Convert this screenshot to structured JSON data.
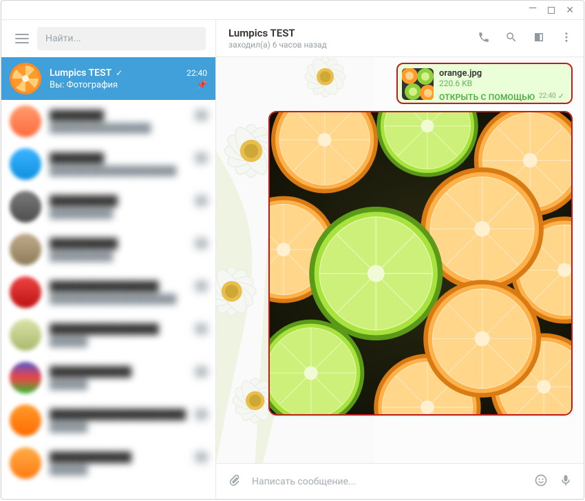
{
  "window_controls": {
    "minimize": "—",
    "maximize": "▢",
    "close": "✕"
  },
  "search": {
    "placeholder": "Найти..."
  },
  "active_chat": {
    "name": "Lumpics TEST",
    "time": "22:40",
    "preview_prefix": "Вы: ",
    "preview": "Фотография"
  },
  "header": {
    "title": "Lumpics TEST",
    "status": "заходил(а) 6 часов назад"
  },
  "file_message": {
    "filename": "orange.jpg",
    "size": "220.6 KB",
    "open_label": "ОТКРЫТЬ С ПОМОЩЬЮ",
    "time": "22:40"
  },
  "compose": {
    "placeholder": "Написать сообщение..."
  },
  "colors": {
    "accent": "#419fd9",
    "bubble_out": "#eaffd8",
    "highlight_border": "#bf1c1c",
    "green": "#5cb85c"
  },
  "blurred_chat_count": 9
}
